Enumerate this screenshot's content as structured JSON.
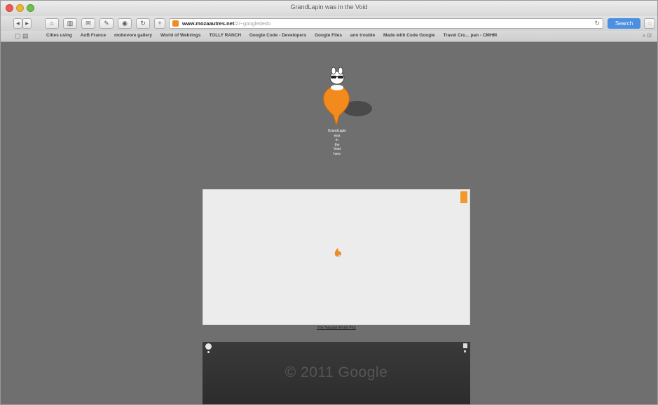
{
  "window": {
    "title": "GrandLapin was in the Void"
  },
  "toolbar": {
    "url_host": "www.mozaautres.net",
    "url_path": "/2/~googlededo",
    "search_label": "Search"
  },
  "bookmarks": [
    "Cities using",
    "AoB France",
    "mobovore gallery",
    "World of Webrings",
    "TOLLY RANCH",
    "Google Code - Developers",
    "Google Files",
    "ann trouble",
    "Made with Code Google",
    "Travel Cru... pan - CMHM"
  ],
  "pin": {
    "label_lines": [
      "GrandLapin",
      "was",
      "in",
      "the",
      "Void",
      "here"
    ]
  },
  "map_panel": {
    "caption": "The Natural World Plot"
  },
  "street_view": {
    "watermark": "© 2011 Google"
  },
  "colors": {
    "accent_orange": "#f08a24",
    "search_blue": "#4a8fe0",
    "page_background": "#6f6f6f"
  },
  "icons": [
    "back-icon",
    "forward-icon",
    "home-icon",
    "bookmarks-icon",
    "mail-icon",
    "pen-icon",
    "safari-icon",
    "reload-icon",
    "add-tab-icon",
    "reader-icon",
    "share-icon"
  ]
}
